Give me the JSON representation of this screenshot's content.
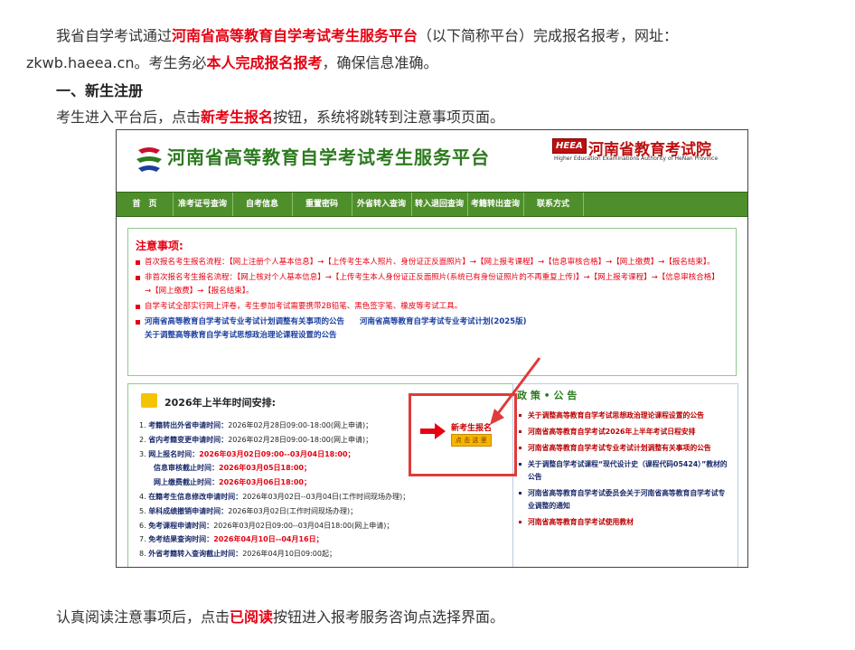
{
  "doc": {
    "intro_a": "我省自学考试通过",
    "intro_platform": "河南省高等教育自学考试考生服务平台",
    "intro_b": "（以下简称平台）完成报名报考，网址：",
    "intro_url": "zkwb.haeea.cn",
    "intro_c": "。考生务必",
    "intro_self": "本人完成报名报考",
    "intro_d": "，确保信息准确。",
    "section1": "一、新生注册",
    "step1_a": "考生进入平台后，点击",
    "step1_btn": "新考生报名",
    "step1_b": "按钮，系统将跳转到注意事项页面。",
    "step2_a": "认真阅读注意事项后，点击",
    "step2_btn": "已阅读",
    "step2_b": "按钮进入报考服务咨询点选择界面。"
  },
  "shot": {
    "site_title": "河南省高等教育自学考试考生服务平台",
    "heea_badge": "HEEA",
    "heea_cn": "河南省教育考试院",
    "heea_en": "Higher Education Examinations Authority of HeNan Province",
    "nav": [
      "首　页",
      "准考证号查询",
      "自考信息",
      "重置密码",
      "外省转入查询",
      "转入退回查询",
      "考籍转出查询",
      "联系方式"
    ],
    "notice_title": "注意事项:",
    "notices": [
      {
        "a": "首次报名考生报名流程：【网上注册个人基本信息】→【上传考生本人照片、身份证正反面照片】→【网上报考课程】→【信息审核合格】→【网上缴费】→【报名结束】。"
      },
      {
        "a": "非首次报名考生报名流程：【网上核对个人基本信息】→【上传考生本人身份证正反面照片(系统已有身份证照片的不再重复上传)】→【网上报考课程】→【信息审核合格】→【网上缴费】→【报名结束】。"
      },
      {
        "a": "自学考试全部实行网上评卷，考生参加考试需要携带2B铅笔、黑色签字笔、橡皮等考试工具。"
      }
    ],
    "link1": "河南省高等教育自学考试专业考试计划调整有关事项的公告",
    "link2": "河南省高等教育自学考试专业考试计划(2025版)",
    "link3": "关于调整高等教育自学考试思想政治理论课程设置的公告",
    "sched_title": "2026年上半年时间安排:",
    "sched": [
      {
        "n": "1.",
        "lbl": "考籍转出外省申请时间：",
        "v": "2026年02月28日09:00-18:00(网上申请)；"
      },
      {
        "n": "2.",
        "lbl": "省内考籍变更申请时间：",
        "v": "2026年02月28日09:00-18:00(网上申请)；"
      },
      {
        "n": "3.",
        "lbl": "网上报名时间：",
        "v": "2026年03月02日09:00--03月04日18:00；",
        "red": true
      },
      {
        "n": "",
        "lbl": "信息审核截止时间：",
        "v": "2026年03月05日18:00；",
        "red": true
      },
      {
        "n": "",
        "lbl": "网上缴费截止时间：",
        "v": "2026年03月06日18:00；",
        "red": true
      },
      {
        "n": "4.",
        "lbl": "在籍考生信息修改申请时间：",
        "v": "2026年03月02日--03月04日(工作时间现场办理)；"
      },
      {
        "n": "5.",
        "lbl": "单科成绩撤销申请时间：",
        "v": "2026年03月02日(工作时间现场办理)；"
      },
      {
        "n": "6.",
        "lbl": "免考课程申请时间：",
        "v": "2026年03月02日09:00--03月04日18:00(网上申请)；"
      },
      {
        "n": "7.",
        "lbl": "免考结果查询时间：",
        "v": "2026年04月10日--04月16日；",
        "red": true
      },
      {
        "n": "8.",
        "lbl": "外省考籍转入查询截止时间：",
        "v": "2026年04月10日09:00起；"
      }
    ],
    "newreg_label": "新考生报名",
    "newreg_btn": "点 击 这 里",
    "policy_title": "政 策 • 公 告",
    "policies": [
      {
        "t": "关于调整高等教育自学考试思想政治理论课程设置的公告",
        "c": "red"
      },
      {
        "t": "河南省高等教育自学考试2026年上半年考试日程安排",
        "c": "red"
      },
      {
        "t": "河南省高等教育自学考试专业考试计划调整有关事项的公告",
        "c": "red"
      },
      {
        "t": "关于调整自学考试课程“现代设计史（课程代码05424）”教材的公告",
        "c": "blue"
      },
      {
        "t": "河南省高等教育自学考试委员会关于河南省高等教育自学考试专业调整的通知",
        "c": "blue"
      },
      {
        "t": "河南省高等教育自学考试使用教材",
        "c": "red"
      }
    ]
  }
}
